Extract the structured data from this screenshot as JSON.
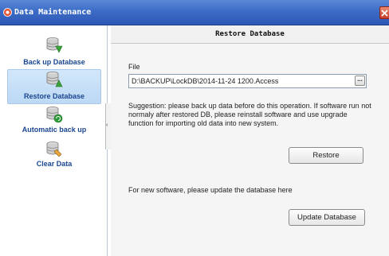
{
  "window": {
    "title": "Data Maintenance",
    "app_icon": "app-logo-icon",
    "close_icon": "close-icon"
  },
  "nav": {
    "items": [
      {
        "label": "Back up Database",
        "icon": "database-backup-icon",
        "selected": false
      },
      {
        "label": "Restore Database",
        "icon": "database-restore-icon",
        "selected": true
      },
      {
        "label": "Automatic back up",
        "icon": "database-auto-backup-icon",
        "selected": false
      },
      {
        "label": "Clear Data",
        "icon": "database-clear-icon",
        "selected": false
      }
    ],
    "collapse_glyph": "‹"
  },
  "content": {
    "header": "Restore Database",
    "file_label": "File",
    "file_value": "D:\\BACKUP\\LockDB\\2014-11-24 1200.Access",
    "browse_label": "...",
    "suggestion": "Suggestion: please back up data before do this operation. If software run not normaly after restored DB, please reinstall software and use upgrade function for importing old data into new system.",
    "restore_label": "Restore",
    "update_note": "For new software, please update the database here",
    "update_label": "Update Database"
  },
  "colors": {
    "titlebar": "#3c6cc6",
    "nav_label": "#1a4690",
    "selected_bg": "#c8e0f8",
    "close_button": "#d65038"
  }
}
